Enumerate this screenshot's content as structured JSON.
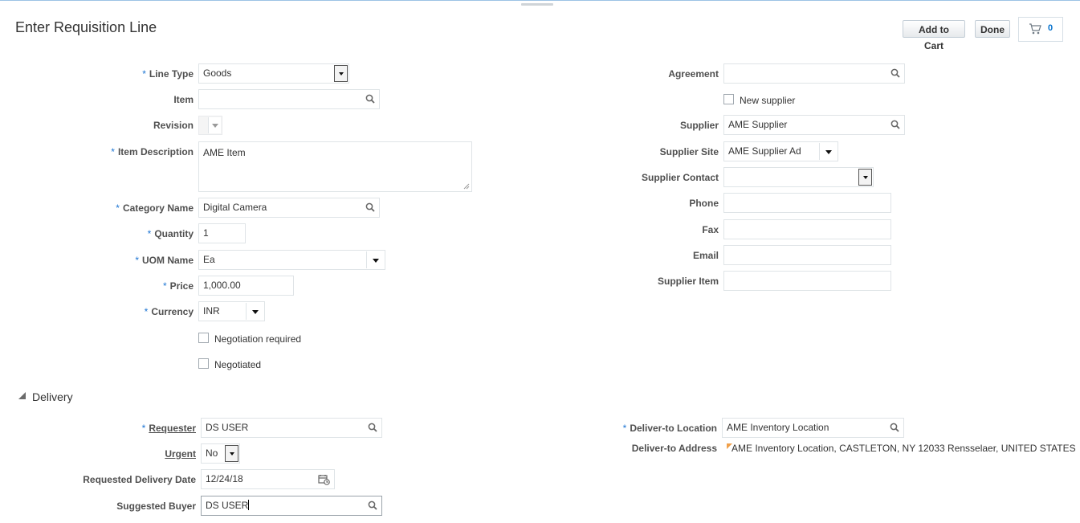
{
  "page": {
    "title": "Enter Requisition Line",
    "buttons": {
      "add_to_cart": "Add to Cart",
      "done": "Done"
    },
    "cart_count": "0"
  },
  "left": {
    "line_type": {
      "label": "Line Type",
      "value": "Goods"
    },
    "item": {
      "label": "Item",
      "value": ""
    },
    "revision": {
      "label": "Revision",
      "value": ""
    },
    "item_description": {
      "label": "Item Description",
      "value": "AME Item"
    },
    "category_name": {
      "label": "Category Name",
      "value": "Digital Camera"
    },
    "quantity": {
      "label": "Quantity",
      "value": "1"
    },
    "uom_name": {
      "label": "UOM Name",
      "value": "Ea"
    },
    "price": {
      "label": "Price",
      "value": "1,000.00"
    },
    "currency": {
      "label": "Currency",
      "value": "INR"
    },
    "negotiation_required": {
      "label": "Negotiation required",
      "checked": false
    },
    "negotiated": {
      "label": "Negotiated",
      "checked": false
    }
  },
  "right": {
    "agreement": {
      "label": "Agreement",
      "value": ""
    },
    "new_supplier": {
      "label": "New supplier",
      "checked": false
    },
    "supplier": {
      "label": "Supplier",
      "value": "AME Supplier"
    },
    "supplier_site": {
      "label": "Supplier Site",
      "value": "AME Supplier Ad"
    },
    "supplier_contact": {
      "label": "Supplier Contact",
      "value": ""
    },
    "phone": {
      "label": "Phone",
      "value": ""
    },
    "fax": {
      "label": "Fax",
      "value": ""
    },
    "email": {
      "label": "Email",
      "value": ""
    },
    "supplier_item": {
      "label": "Supplier Item",
      "value": ""
    }
  },
  "delivery": {
    "section_label": "Delivery",
    "requester": {
      "label": "Requester",
      "value": "DS USER"
    },
    "urgent": {
      "label": "Urgent",
      "value": "No"
    },
    "requested_delivery_date": {
      "label": "Requested Delivery Date",
      "value": "12/24/18"
    },
    "suggested_buyer": {
      "label": "Suggested Buyer",
      "value": "DS USER"
    },
    "deliver_to_location": {
      "label": "Deliver-to Location",
      "value": "AME Inventory Location"
    },
    "deliver_to_address": {
      "label": "Deliver-to Address",
      "value": "AME Inventory Location, CASTLETON, NY 12033 Rensselaer, UNITED STATES"
    }
  },
  "icons": {
    "search": "search-icon",
    "dropdown": "chevron-down-icon",
    "calendar": "calendar-icon",
    "cart": "cart-icon",
    "collapse": "triangle-down-icon"
  },
  "colors": {
    "required_star": "#1d75d3",
    "cart_count": "#0572ce"
  }
}
